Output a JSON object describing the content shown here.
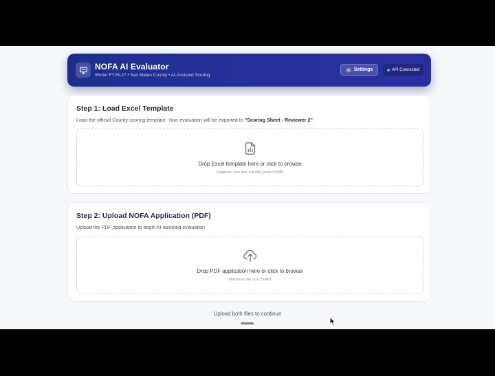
{
  "header": {
    "title": "NOFA AI Evaluator",
    "subtitle": "Winter FY26-27 • San Mateo County • AI-Assisted Scoring",
    "settings_label": "Settings",
    "api_status": "API Connected",
    "logo_icon": "monitor-icon",
    "settings_icon": "gear-icon"
  },
  "step1": {
    "title": "Step 1: Load Excel Template",
    "desc_prefix": "Load the official County scoring template. Your evaluation will be exported to ",
    "desc_bold": "\"Scoring Sheet - Reviewer 2\"",
    "desc_suffix": ".",
    "drop_main": "Drop Excel template here or click to browse",
    "drop_sub": "Supports .xlsx and .xls files (max 50MB)",
    "icon": "spreadsheet-file-icon"
  },
  "step2": {
    "title": "Step 2: Upload NOFA Application (PDF)",
    "desc": "Upload the PDF application to begin AI-assisted evaluation",
    "drop_main": "Drop PDF application here or click to browse",
    "drop_sub": "Maximum file size: 50MB",
    "icon": "cloud-upload-icon"
  },
  "footer": {
    "status": "Upload both files to continue"
  },
  "colors": {
    "header_gradient_start": "#1d2d8c",
    "header_gradient_end": "#2a2f9e",
    "status_dot": "#34d399"
  }
}
